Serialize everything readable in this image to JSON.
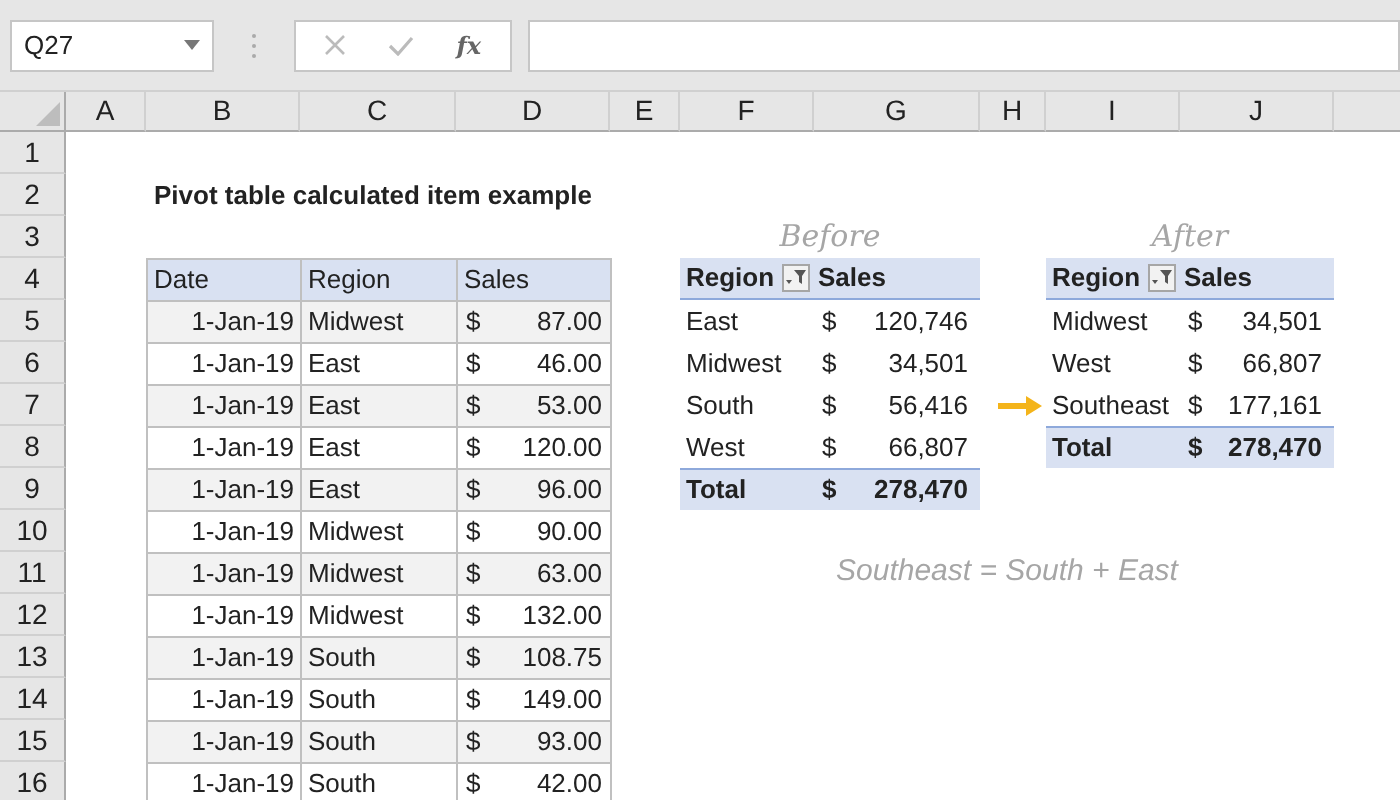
{
  "formula_bar": {
    "name_box": "Q27",
    "function_label": "fx"
  },
  "column_headers": [
    "A",
    "B",
    "C",
    "D",
    "E",
    "F",
    "G",
    "H",
    "I",
    "J"
  ],
  "row_headers": [
    "1",
    "2",
    "3",
    "4",
    "5",
    "6",
    "7",
    "8",
    "9",
    "10",
    "11",
    "12",
    "13",
    "14",
    "15",
    "16"
  ],
  "title": "Pivot table calculated item example",
  "before_label": "Before",
  "after_label": "After",
  "note": "Southeast = South + East",
  "source_table": {
    "columns": [
      "Date",
      "Region",
      "Sales"
    ],
    "rows": [
      {
        "date": "1-Jan-19",
        "region": "Midwest",
        "currency": "$",
        "amount": "87.00"
      },
      {
        "date": "1-Jan-19",
        "region": "East",
        "currency": "$",
        "amount": "46.00"
      },
      {
        "date": "1-Jan-19",
        "region": "East",
        "currency": "$",
        "amount": "53.00"
      },
      {
        "date": "1-Jan-19",
        "region": "East",
        "currency": "$",
        "amount": "120.00"
      },
      {
        "date": "1-Jan-19",
        "region": "East",
        "currency": "$",
        "amount": "96.00"
      },
      {
        "date": "1-Jan-19",
        "region": "Midwest",
        "currency": "$",
        "amount": "90.00"
      },
      {
        "date": "1-Jan-19",
        "region": "Midwest",
        "currency": "$",
        "amount": "63.00"
      },
      {
        "date": "1-Jan-19",
        "region": "Midwest",
        "currency": "$",
        "amount": "132.00"
      },
      {
        "date": "1-Jan-19",
        "region": "South",
        "currency": "$",
        "amount": "108.75"
      },
      {
        "date": "1-Jan-19",
        "region": "South",
        "currency": "$",
        "amount": "149.00"
      },
      {
        "date": "1-Jan-19",
        "region": "South",
        "currency": "$",
        "amount": "93.00"
      },
      {
        "date": "1-Jan-19",
        "region": "South",
        "currency": "$",
        "amount": "42.00"
      }
    ]
  },
  "pivot_before": {
    "columns": [
      "Region",
      "Sales"
    ],
    "rows": [
      {
        "region": "East",
        "currency": "$",
        "amount": "120,746"
      },
      {
        "region": "Midwest",
        "currency": "$",
        "amount": "34,501"
      },
      {
        "region": "South",
        "currency": "$",
        "amount": "56,416"
      },
      {
        "region": "West",
        "currency": "$",
        "amount": "66,807"
      }
    ],
    "total": {
      "label": "Total",
      "currency": "$",
      "amount": "278,470"
    }
  },
  "pivot_after": {
    "columns": [
      "Region",
      "Sales"
    ],
    "rows": [
      {
        "region": "Midwest",
        "currency": "$",
        "amount": "34,501"
      },
      {
        "region": "West",
        "currency": "$",
        "amount": "66,807"
      },
      {
        "region": "Southeast",
        "currency": "$",
        "amount": "177,161"
      }
    ],
    "total": {
      "label": "Total",
      "currency": "$",
      "amount": "278,470"
    }
  }
}
